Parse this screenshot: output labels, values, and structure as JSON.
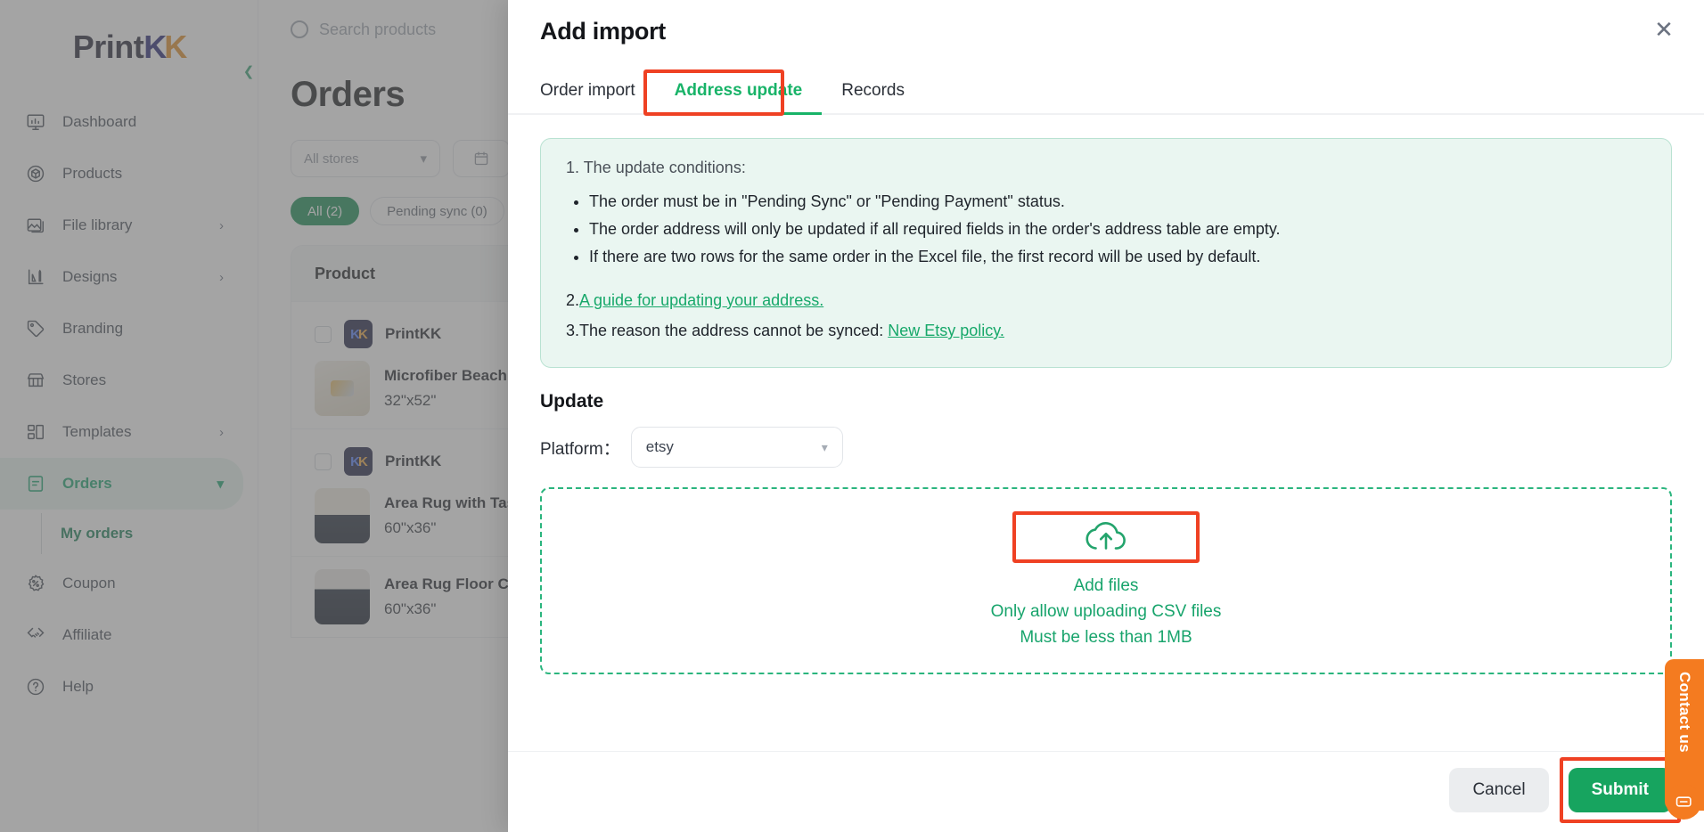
{
  "brand": {
    "name_prefix": "Print",
    "k1": "K",
    "k2": "K"
  },
  "sidebar": {
    "items": [
      {
        "label": "Dashboard",
        "icon": "monitor-chart-icon",
        "chevron": "",
        "active": false
      },
      {
        "label": "Products",
        "icon": "cube-circle-icon",
        "chevron": "",
        "active": false
      },
      {
        "label": "File library",
        "icon": "image-icon",
        "chevron": "›",
        "active": false
      },
      {
        "label": "Designs",
        "icon": "pen-chart-icon",
        "chevron": "›",
        "active": false
      },
      {
        "label": "Branding",
        "icon": "tag-icon",
        "chevron": "",
        "active": false
      },
      {
        "label": "Stores",
        "icon": "storefront-icon",
        "chevron": "",
        "active": false
      },
      {
        "label": "Templates",
        "icon": "layout-grid-icon",
        "chevron": "›",
        "active": false
      },
      {
        "label": "Orders",
        "icon": "document-list-icon",
        "chevron": "⌄",
        "active": true
      },
      {
        "label": "Coupon",
        "icon": "percent-badge-icon",
        "chevron": "",
        "active": false
      },
      {
        "label": "Affiliate",
        "icon": "handshake-icon",
        "chevron": "",
        "active": false
      },
      {
        "label": "Help",
        "icon": "question-circle-icon",
        "chevron": "",
        "active": false
      }
    ],
    "submenu": {
      "label": "My orders"
    }
  },
  "topbar": {
    "search_placeholder": "Search products"
  },
  "page": {
    "title": "Orders",
    "store_filter": "All stores",
    "pills": [
      {
        "label": "All (2)",
        "selected": true
      },
      {
        "label": "Pending sync (0)",
        "selected": false
      }
    ],
    "table": {
      "header": "Product",
      "rows": [
        {
          "store": "PrintKK",
          "product": "Microfiber Beach T.",
          "size": "32\"x52\"",
          "thumb": "t-towel"
        },
        {
          "store": "PrintKK",
          "product": "Area Rug with Tass.",
          "size": "60\"x36\"",
          "thumb": "t-rug1"
        },
        {
          "store": "",
          "product": "Area Rug Floor Car",
          "size": "60\"x36\"",
          "thumb": "t-rug2"
        }
      ]
    }
  },
  "modal": {
    "title": "Add import",
    "close_icon": "✕",
    "tabs": [
      {
        "label": "Order import",
        "active": false
      },
      {
        "label": "Address update",
        "active": true
      },
      {
        "label": "Records",
        "active": false
      }
    ],
    "info": {
      "line1": "1. The update conditions:",
      "bullets": [
        "The order must be in \"Pending Sync\" or \"Pending Payment\" status.",
        "The order address will only be updated if all required fields in the order's address table are empty.",
        "If there are two rows for the same order in the Excel file, the first record will be used by default."
      ],
      "line2_prefix": "2.",
      "line2_link": "A guide for updating your address.",
      "line3_prefix": "3.The reason the address cannot be synced: ",
      "line3_link": "New Etsy policy."
    },
    "update": {
      "section_title": "Update",
      "platform_label": "Platform：",
      "platform_value": "etsy",
      "platform_options": [
        "etsy"
      ]
    },
    "dropzone": {
      "icon": "cloud-upload-icon",
      "line1": "Add files",
      "line2": "Only allow uploading CSV files",
      "line3": "Must be less than 1MB"
    },
    "footer": {
      "cancel_label": "Cancel",
      "submit_label": "Submit"
    }
  },
  "contact": {
    "label": "Contact us",
    "icon": "chat-bubble-icon"
  },
  "colors": {
    "brand_green": "#17a45f",
    "tab_active_green": "#18b368",
    "highlight_red": "#ef4123",
    "info_bg": "#eaf6f1",
    "info_border": "#b9e2d2",
    "dropzone_green": "#2bb57e",
    "contact_orange": "#f47b20",
    "pill_selected_green": "#0f8a4e"
  }
}
